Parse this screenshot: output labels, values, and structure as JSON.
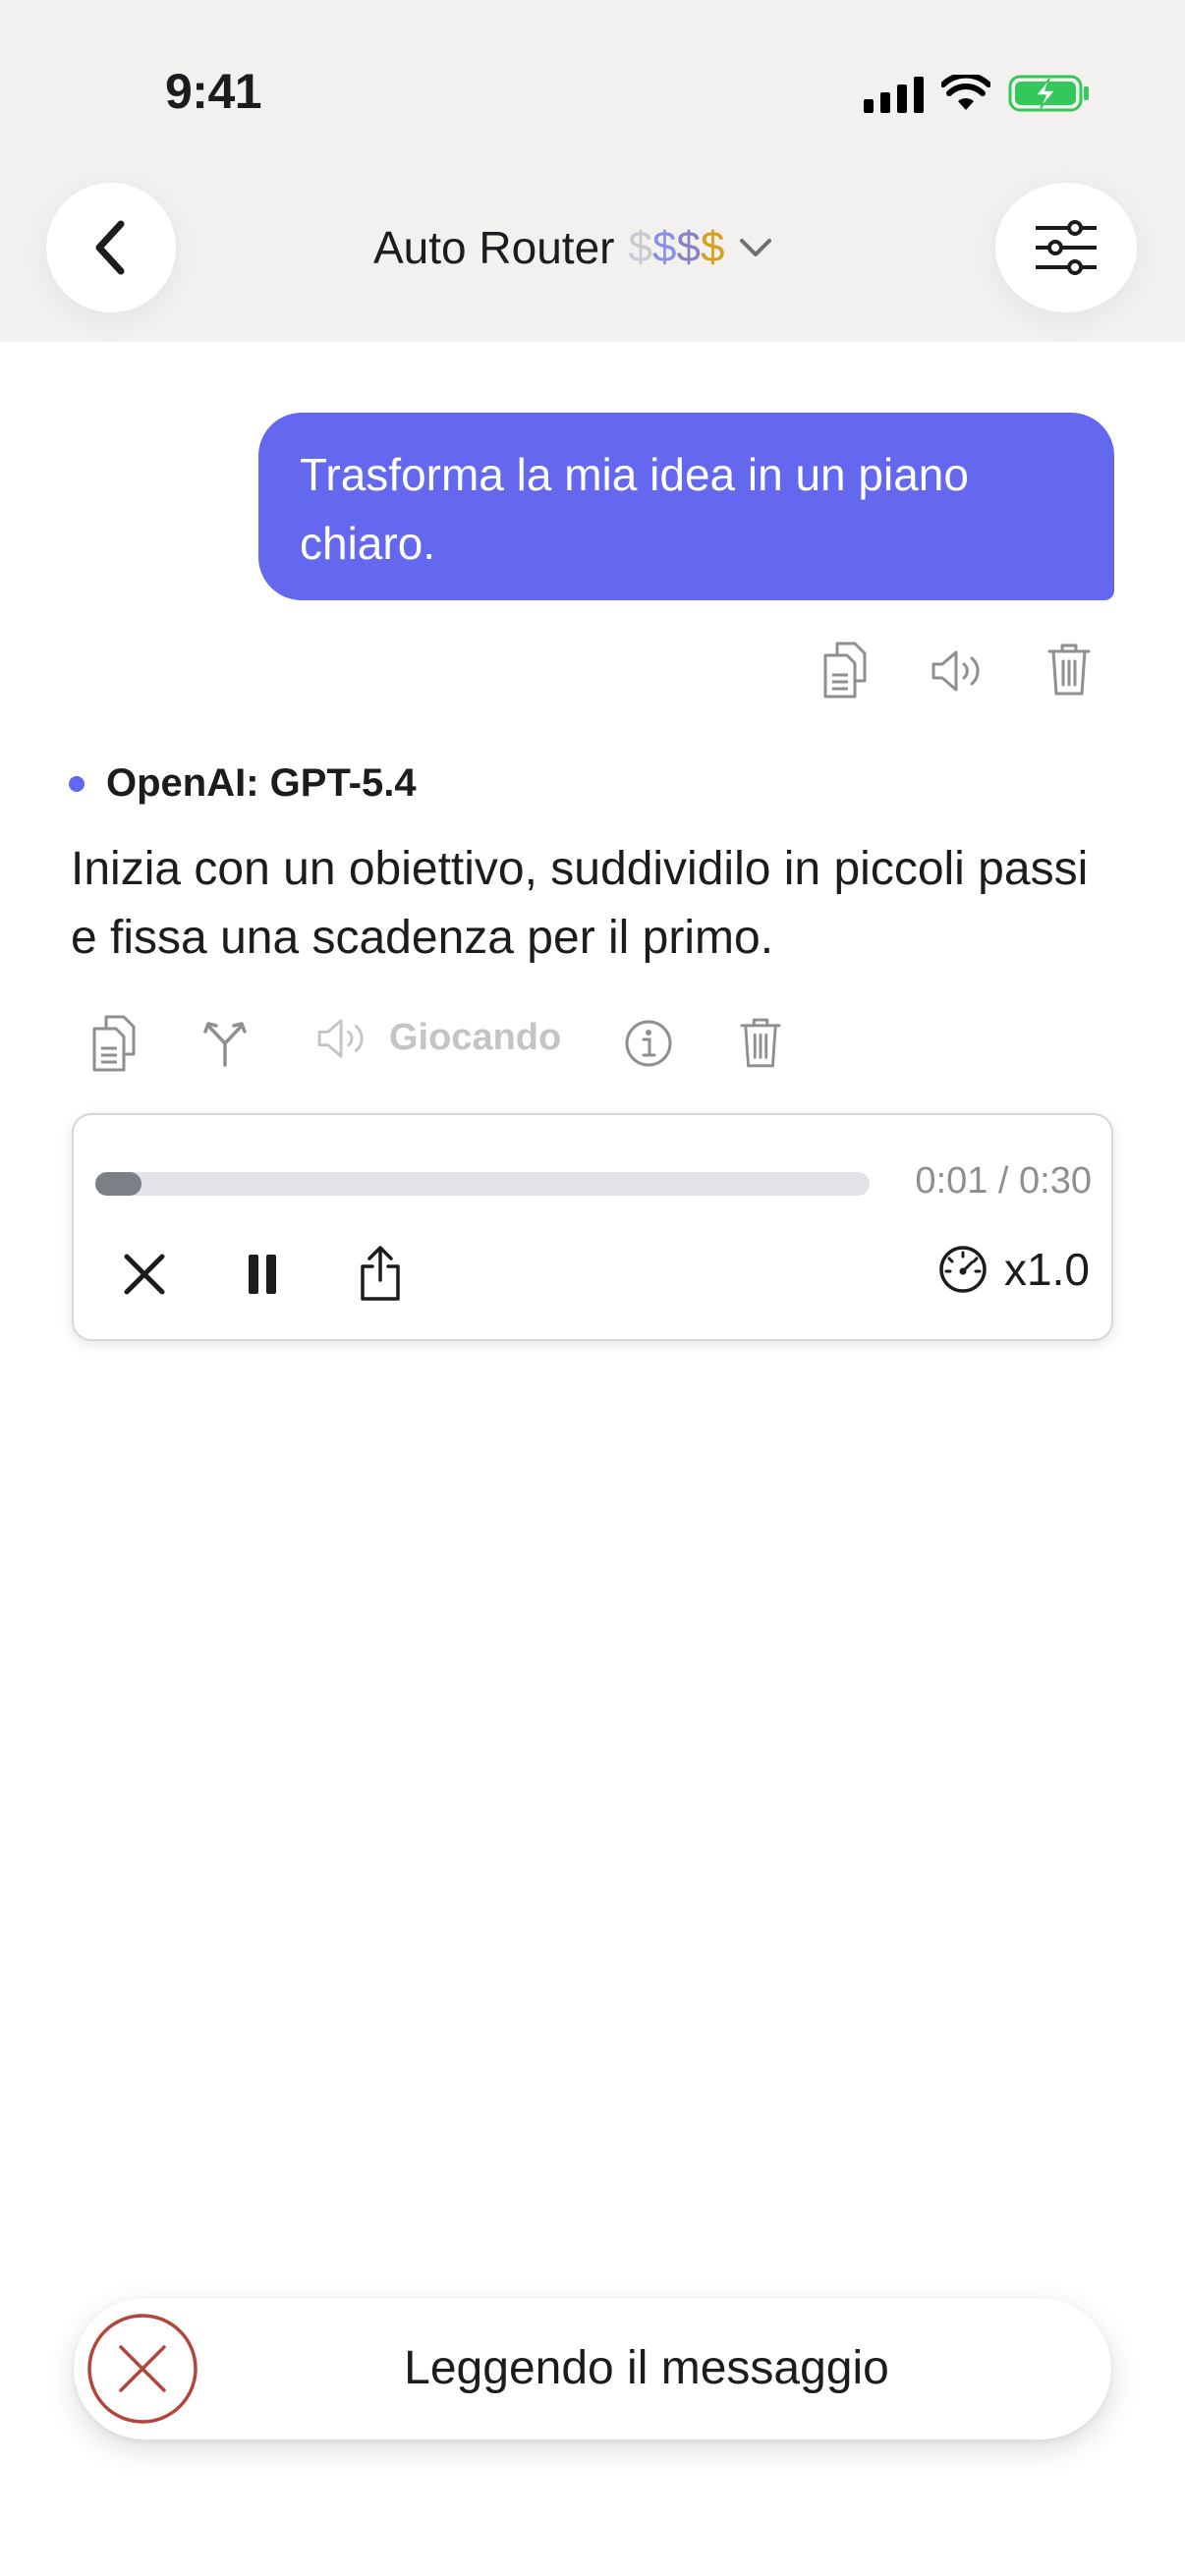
{
  "status_bar": {
    "time": "9:41"
  },
  "header": {
    "model_name": "Auto Router",
    "price_symbols": [
      "$",
      "$",
      "$",
      "$"
    ],
    "price_colors": [
      "#c9c9d1",
      "#8a90e8",
      "#8a80c4",
      "#d4a020"
    ]
  },
  "user_message": {
    "text": "Trasforma la mia idea in un piano chiaro.",
    "actions": [
      "copy-icon",
      "speaker-icon",
      "trash-icon"
    ]
  },
  "assistant_message": {
    "model": "OpenAI: GPT-5.4",
    "text": "Inizia con un obiettivo, suddividilo in piccoli passi e fissa una scadenza per il primo.",
    "playing_label": "Giocando",
    "actions": [
      "copy-icon",
      "branch-icon",
      "speaker-icon",
      "info-icon",
      "trash-icon"
    ]
  },
  "audio_player": {
    "time_display": "0:01 / 0:30",
    "progress": 0.033,
    "speed_label": "x1.0"
  },
  "toast": {
    "text": "Leggendo il messaggio"
  },
  "colors": {
    "accent": "#6368ef",
    "header_bg": "#f2f1ef",
    "cancel_red": "#b5443a",
    "battery_green": "#34c759"
  }
}
